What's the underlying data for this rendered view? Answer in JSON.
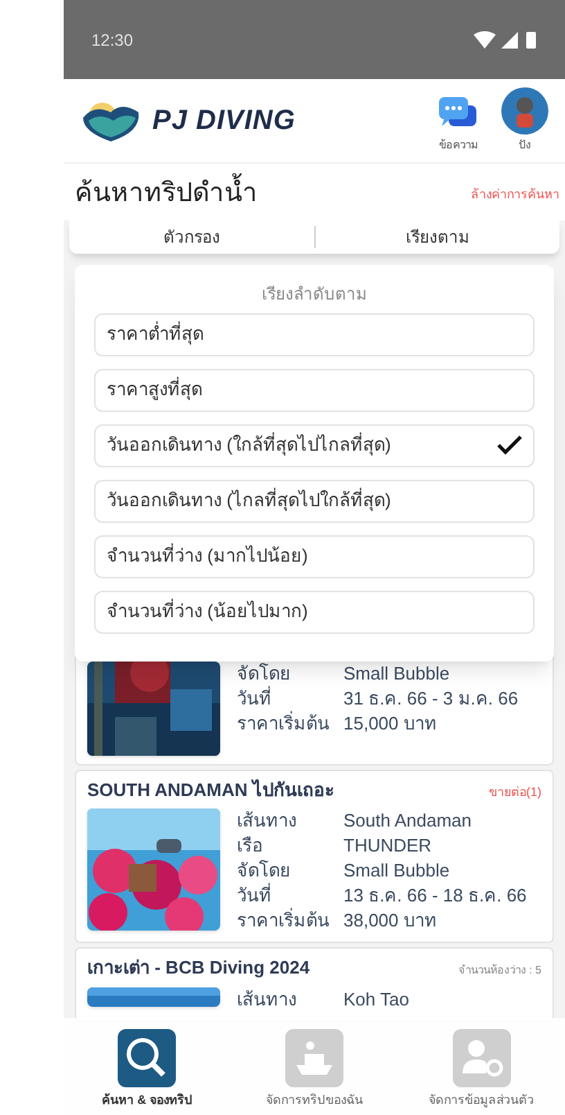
{
  "status_bar": {
    "time": "12:30"
  },
  "header": {
    "brand": "PJ DIVING",
    "actions": [
      {
        "kind": "chat",
        "label": "ข้อความ"
      },
      {
        "kind": "avatar",
        "label": "ปัง"
      }
    ]
  },
  "search": {
    "title": "ค้นหาทริปดำน้ำ",
    "clear_link": "ล้างค่าการค้นหา",
    "tabs": [
      "ตัวกรอง",
      "เรียงตาม"
    ]
  },
  "sort_panel": {
    "title": "เรียงลำดับตาม",
    "options": [
      {
        "label": "ราคาต่ำที่สุด",
        "selected": false
      },
      {
        "label": "ราคาสูงที่สุด",
        "selected": false
      },
      {
        "label": "วันออกเดินทาง (ใกล้ที่สุดไปไกลที่สุด)",
        "selected": true
      },
      {
        "label": "วันออกเดินทาง (ไกลที่สุดไปใกล้ที่สุด)",
        "selected": false
      },
      {
        "label": "จำนวนที่ว่าง (มากไปน้อย)",
        "selected": false
      },
      {
        "label": "จำนวนที่ว่าง (น้อยไปมาก)",
        "selected": false
      }
    ]
  },
  "trips": [
    {
      "rows": [
        {
          "label": "จัดโดย",
          "value": "Small Bubble"
        },
        {
          "label": "วันที่",
          "value": "31 ธ.ค. 66 - 3 ม.ค. 66"
        },
        {
          "label": "ราคาเริ่มต้น",
          "value": "15,000 บาท"
        }
      ]
    },
    {
      "title": "SOUTH ANDAMAN ไปกันเถอะ",
      "badge": {
        "kind": "resale",
        "text": "ขายต่อ(1)"
      },
      "rows": [
        {
          "label": "เส้นทาง",
          "value": "South Andaman"
        },
        {
          "label": "เรือ",
          "value": "THUNDER"
        },
        {
          "label": "จัดโดย",
          "value": "Small Bubble"
        },
        {
          "label": "วันที่",
          "value": "13 ธ.ค. 66 - 18 ธ.ค. 66"
        },
        {
          "label": "ราคาเริ่มต้น",
          "value": "38,000 บาท"
        }
      ]
    },
    {
      "title": "เกาะเต่า - BCB Diving 2024",
      "badge": {
        "kind": "rooms",
        "text": "จำนวนห้องว่าง : 5"
      },
      "rows": [
        {
          "label": "เส้นทาง",
          "value": "Koh Tao"
        }
      ]
    }
  ],
  "bottom_nav": [
    {
      "kind": "search",
      "label": "ค้นหา & จองทริป",
      "selected": true
    },
    {
      "kind": "boat",
      "label": "จัดการทริปของฉัน",
      "selected": false
    },
    {
      "kind": "profile",
      "label": "จัดการข้อมูลส่วนตัว",
      "selected": false
    }
  ]
}
